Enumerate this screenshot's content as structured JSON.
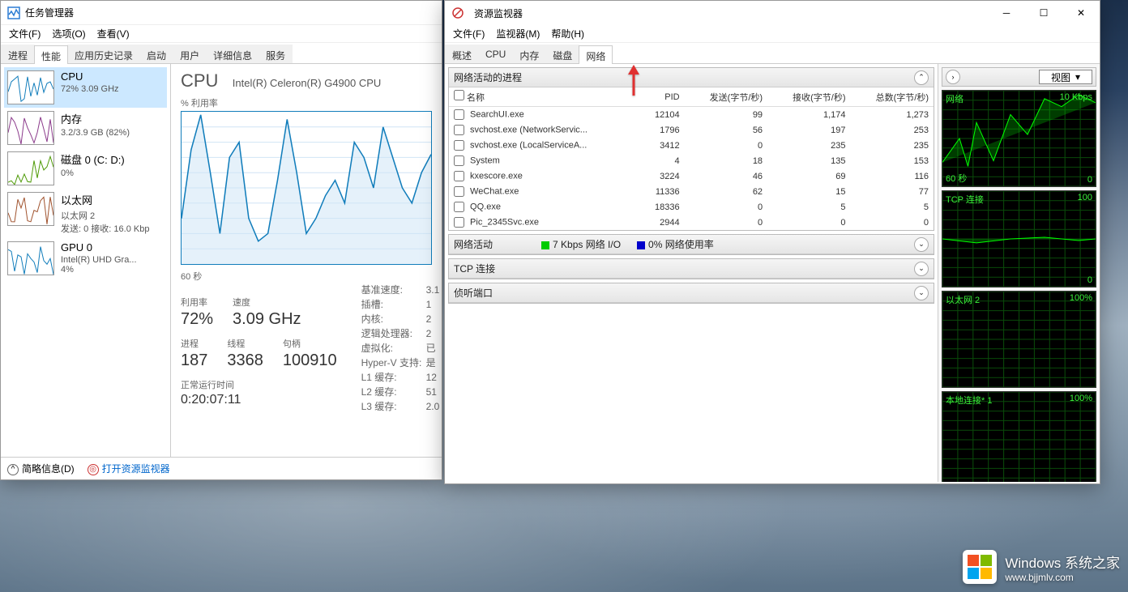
{
  "task_manager": {
    "title": "任务管理器",
    "menu": [
      "文件(F)",
      "选项(O)",
      "查看(V)"
    ],
    "tabs": [
      "进程",
      "性能",
      "应用历史记录",
      "启动",
      "用户",
      "详细信息",
      "服务"
    ],
    "active_tab": 1,
    "sidebar": [
      {
        "title": "CPU",
        "sub": "72% 3.09 GHz",
        "color": "#117dbb",
        "active": true
      },
      {
        "title": "内存",
        "sub": "3.2/3.9 GB (82%)",
        "color": "#8b3a8b"
      },
      {
        "title": "磁盘 0 (C: D:)",
        "sub": "0%",
        "color": "#4e9a06"
      },
      {
        "title": "以太网",
        "sub": "以太网 2",
        "sub2": "发送: 0 接收: 16.0 Kbp",
        "color": "#a0522d"
      },
      {
        "title": "GPU 0",
        "sub": "Intel(R) UHD Gra...",
        "sub2": "4%",
        "color": "#117dbb"
      }
    ],
    "cpu_heading": "CPU",
    "cpu_model": "Intel(R) Celeron(R) G4900 CPU",
    "chart_top_label": "% 利用率",
    "chart_bot_label": "60 秒",
    "stats1": [
      {
        "label": "利用率",
        "value": "72%"
      },
      {
        "label": "速度",
        "value": "3.09 GHz"
      }
    ],
    "stats2": [
      {
        "label": "进程",
        "value": "187"
      },
      {
        "label": "线程",
        "value": "3368"
      },
      {
        "label": "句柄",
        "value": "100910"
      }
    ],
    "uptime_label": "正常运行时间",
    "uptime": "0:20:07:11",
    "details": [
      [
        "基准速度:",
        "3.1"
      ],
      [
        "插槽:",
        "1"
      ],
      [
        "内核:",
        "2"
      ],
      [
        "逻辑处理器:",
        "2"
      ],
      [
        "虚拟化:",
        "已"
      ],
      [
        "Hyper-V 支持:",
        "是"
      ],
      [
        "L1 缓存:",
        "12"
      ],
      [
        "L2 缓存:",
        "51"
      ],
      [
        "L3 缓存:",
        "2.0"
      ]
    ],
    "status_less": "简略信息(D)",
    "status_open": "打开资源监视器"
  },
  "resource_monitor": {
    "title": "资源监视器",
    "menu": [
      "文件(F)",
      "监视器(M)",
      "帮助(H)"
    ],
    "tabs": [
      "概述",
      "CPU",
      "内存",
      "磁盘",
      "网络"
    ],
    "active_tab": 4,
    "panel_processes": "网络活动的进程",
    "columns": [
      "名称",
      "PID",
      "发送(字节/秒)",
      "接收(字节/秒)",
      "总数(字节/秒)"
    ],
    "processes": [
      {
        "name": "SearchUI.exe",
        "pid": "12104",
        "send": "99",
        "recv": "1,174",
        "total": "1,273"
      },
      {
        "name": "svchost.exe (NetworkServic...",
        "pid": "1796",
        "send": "56",
        "recv": "197",
        "total": "253"
      },
      {
        "name": "svchost.exe (LocalServiceA...",
        "pid": "3412",
        "send": "0",
        "recv": "235",
        "total": "235"
      },
      {
        "name": "System",
        "pid": "4",
        "send": "18",
        "recv": "135",
        "total": "153"
      },
      {
        "name": "kxescore.exe",
        "pid": "3224",
        "send": "46",
        "recv": "69",
        "total": "116"
      },
      {
        "name": "WeChat.exe",
        "pid": "11336",
        "send": "62",
        "recv": "15",
        "total": "77"
      },
      {
        "name": "QQ.exe",
        "pid": "18336",
        "send": "0",
        "recv": "5",
        "total": "5"
      },
      {
        "name": "Pic_2345Svc.exe",
        "pid": "2944",
        "send": "0",
        "recv": "0",
        "total": "0"
      }
    ],
    "panel_activity": "网络活动",
    "activity_io": "7 Kbps 网络 I/O",
    "activity_usage": "0% 网络使用率",
    "panel_tcp": "TCP 连接",
    "panel_listen": "侦听端口",
    "view_btn": "视图",
    "side_charts": [
      {
        "title": "网络",
        "right": "10 Kbps",
        "bl": "60 秒",
        "br": "0"
      },
      {
        "title": "TCP 连接",
        "right": "100",
        "bl": "",
        "br": "0"
      },
      {
        "title": "以太网 2",
        "right": "100%",
        "bl": "",
        "br": ""
      },
      {
        "title": "本地连接* 1",
        "right": "100%",
        "bl": "",
        "br": ""
      }
    ]
  },
  "watermark": {
    "brand": "Windows 系统之家",
    "url": "www.bjjmlv.com"
  },
  "chart_data": {
    "type": "line",
    "title": "CPU % 利用率",
    "xlabel": "60 秒",
    "ylabel": "%",
    "ylim": [
      0,
      100
    ],
    "values": [
      30,
      75,
      98,
      60,
      20,
      70,
      80,
      30,
      15,
      20,
      55,
      95,
      60,
      20,
      30,
      45,
      55,
      40,
      80,
      70,
      50,
      90,
      70,
      50,
      40,
      60,
      72
    ]
  }
}
